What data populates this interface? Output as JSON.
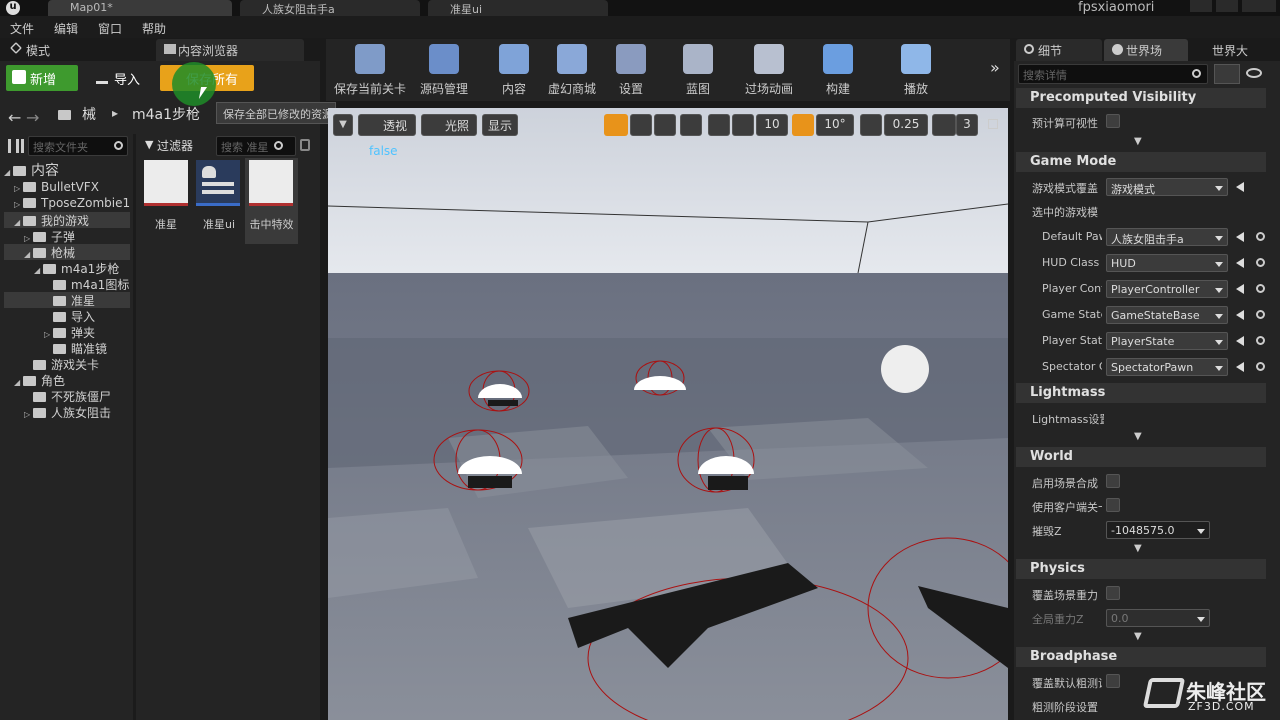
{
  "window": {
    "tabs": [
      "Map01*",
      "人族女阻击手a",
      "准星ui"
    ],
    "user": "fpsxiaomori"
  },
  "menubar": {
    "items": [
      "文件",
      "编辑",
      "窗口",
      "帮助"
    ]
  },
  "left_tabs": {
    "modes": "模式",
    "content_browser": "内容浏览器"
  },
  "content_browser": {
    "new_label": "新增",
    "import_label": "导入",
    "save_all_label": "保存所有",
    "tooltip": "保存全部已修改的资源。",
    "path": [
      "械",
      "m4a1步枪"
    ],
    "folder_search_placeholder": "搜索文件夹",
    "filter_label": "过滤器",
    "asset_search_placeholder": "搜索 准星",
    "tree": [
      {
        "label": "内容",
        "indent": 0
      },
      {
        "label": "BulletVFX",
        "indent": 1
      },
      {
        "label": "TposeZombie1",
        "indent": 1
      },
      {
        "label": "我的游戏",
        "indent": 1
      },
      {
        "label": "子弹",
        "indent": 2
      },
      {
        "label": "枪械",
        "indent": 2
      },
      {
        "label": "m4a1步枪",
        "indent": 3
      },
      {
        "label": "m4a1图标",
        "indent": 4
      },
      {
        "label": "准星",
        "indent": 4
      },
      {
        "label": "导入",
        "indent": 4
      },
      {
        "label": "弹夹",
        "indent": 4
      },
      {
        "label": "瞄准镜",
        "indent": 4
      },
      {
        "label": "游戏关卡",
        "indent": 2
      },
      {
        "label": "角色",
        "indent": 1
      },
      {
        "label": "不死族僵尸",
        "indent": 2
      },
      {
        "label": "人族女阻击",
        "indent": 2
      }
    ],
    "assets": [
      "准星",
      "准星ui",
      "击中特效"
    ]
  },
  "toolbar": {
    "items": [
      "保存当前关卡",
      "源码管理",
      "内容",
      "虚幻商城",
      "设置",
      "蓝图",
      "过场动画",
      "构建",
      "播放"
    ]
  },
  "viewport": {
    "perspective": "透视",
    "lighting": "光照",
    "show": "显示",
    "grid_snap": "10",
    "rot_snap": "10°",
    "scale_snap": "0.25",
    "cam_speed": "3",
    "debug_text": "false"
  },
  "right_tabs": {
    "details": "细节",
    "world_settings": "世界场",
    "world_outliner": "世界大"
  },
  "details": {
    "search_placeholder": "搜索详情",
    "sections": {
      "precomputed": "Precomputed Visibility",
      "game_mode": "Game Mode",
      "lightmass": "Lightmass",
      "world": "World",
      "physics": "Physics",
      "broadphase": "Broadphase"
    },
    "props": {
      "precomputed_vis": "预计算可视性",
      "game_mode_override": "游戏模式覆盖",
      "game_mode_value": "游戏模式",
      "selected_game_mode": "选中的游戏模",
      "default_pawn": "Default Paw",
      "default_pawn_value": "人族女阻击手a",
      "hud_class": "HUD Class",
      "hud_value": "HUD",
      "player_controller": "Player Cont",
      "player_controller_value": "PlayerController",
      "game_state": "Game State",
      "game_state_value": "GameStateBase",
      "player_state": "Player State",
      "player_state_value": "PlayerState",
      "spectator": "Spectator C",
      "spectator_value": "SpectatorPawn",
      "lightmass_settings": "Lightmass设置",
      "world_composition": "启用场景合成",
      "client_nav": "使用客户端关卡",
      "kill_z": "摧毁Z",
      "kill_z_value": "-1048575.0",
      "override_gravity": "覆盖场景重力",
      "global_gravity": "全局重力Z",
      "global_gravity_value": "0.0",
      "override_broadphase": "覆盖默认粗测设",
      "broadphase_settings": "粗测阶段设置"
    }
  },
  "watermark": {
    "brand": "朱峰社区",
    "url": "ZF3D.COM"
  }
}
